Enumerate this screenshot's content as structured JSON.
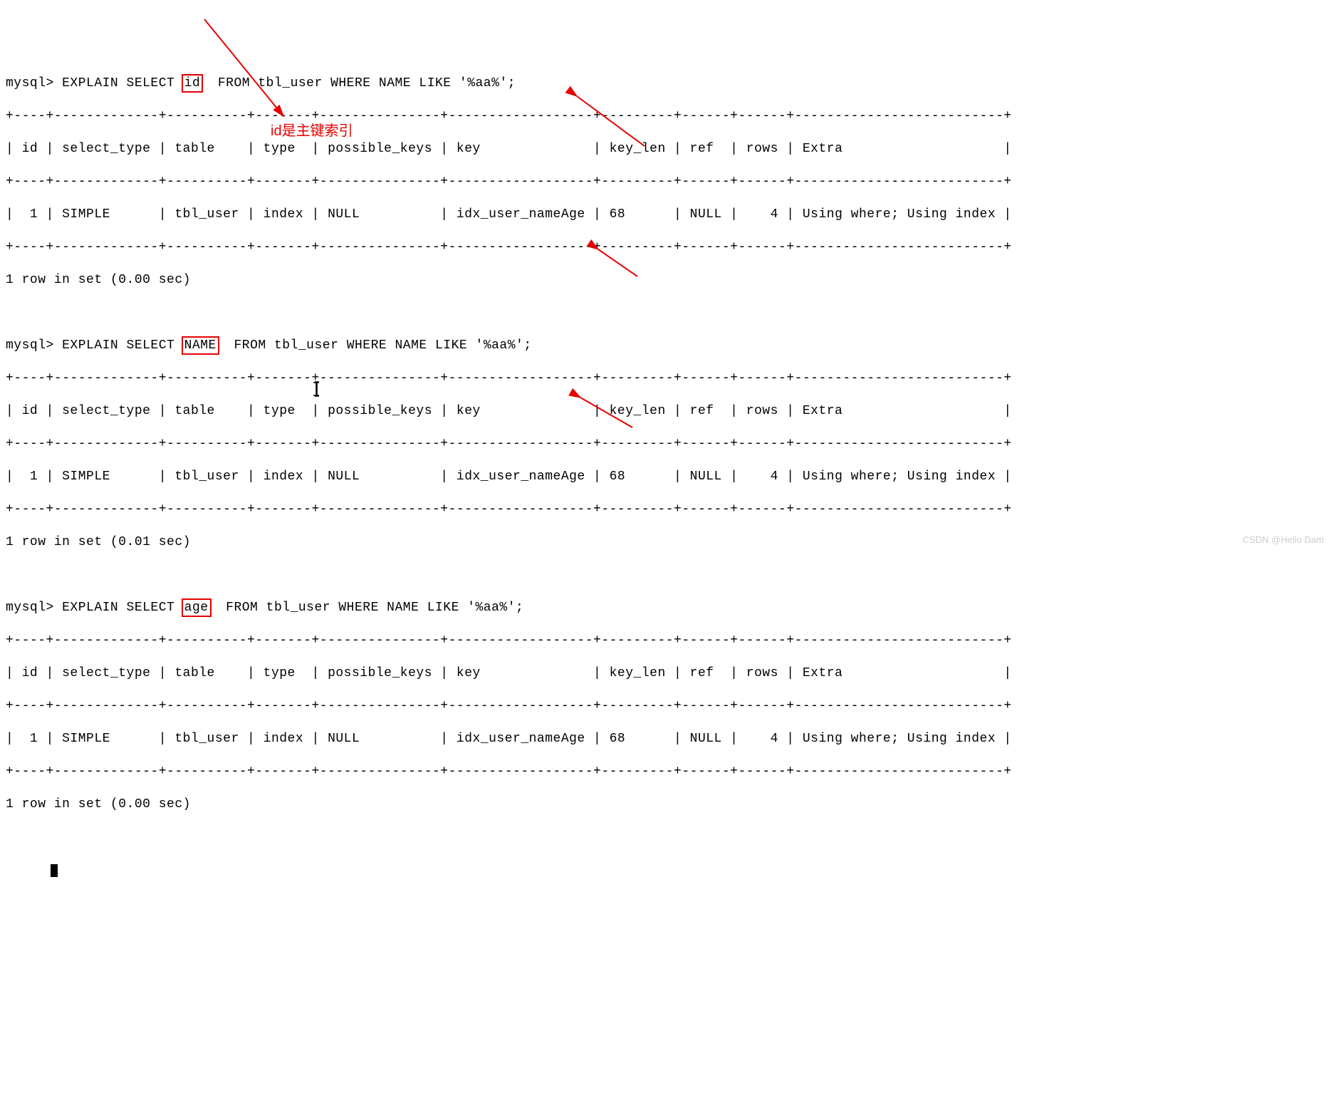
{
  "queries": [
    {
      "prompt": "mysql>",
      "pre": " EXPLAIN SELECT ",
      "boxed": "id",
      "post": "  FROM tbl_user WHERE NAME LIKE '%aa%';",
      "hr": "+----+-------------+----------+-------+---------------+------------------+---------+------+------+--------------------------+",
      "header": "| id | select_type | table    | type  | possible_keys | key              | key_len | ref  | rows | Extra                    |",
      "data": "|  1 | SIMPLE      | tbl_user | index | NULL          | idx_user_nameAge | 68      | NULL |    4 | Using where; Using index |",
      "rows": "1 row in set (0.00 sec)"
    },
    {
      "prompt": "mysql>",
      "pre": " EXPLAIN SELECT ",
      "boxed": "NAME",
      "post": "  FROM tbl_user WHERE NAME LIKE '%aa%';",
      "hr": "+----+-------------+----------+-------+---------------+------------------+---------+------+------+--------------------------+",
      "header": "| id | select_type | table    | type  | possible_keys | key              | key_len | ref  | rows | Extra                    |",
      "data": "|  1 | SIMPLE      | tbl_user | index | NULL          | idx_user_nameAge | 68      | NULL |    4 | Using where; Using index |",
      "rows": "1 row in set (0.01 sec)"
    },
    {
      "prompt": "mysql>",
      "pre": " EXPLAIN SELECT ",
      "boxed": "age",
      "post": "  FROM tbl_user WHERE NAME LIKE '%aa%';",
      "hr": "+----+-------------+----------+-------+---------------+------------------+---------+------+------+--------------------------+",
      "header": "| id | select_type | table    | type  | possible_keys | key              | key_len | ref  | rows | Extra                    |",
      "data": "|  1 | SIMPLE      | tbl_user | index | NULL          | idx_user_nameAge | 68      | NULL |    4 | Using where; Using index |",
      "rows": "1 row in set (0.00 sec)"
    }
  ],
  "annotation": "id是主键索引",
  "watermark": "CSDN @Hello Dam"
}
